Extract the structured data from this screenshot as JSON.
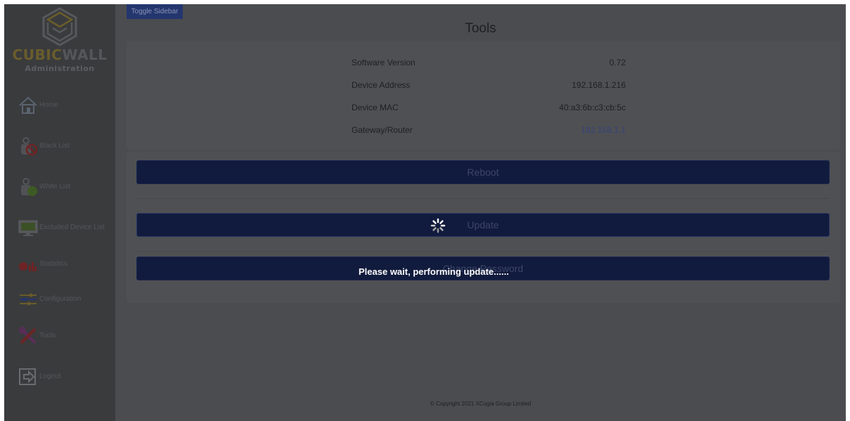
{
  "brand": {
    "name_part1": "CUBIC",
    "name_part2": "WALL",
    "subtitle": "Administration"
  },
  "sidebar": {
    "items": [
      {
        "label": "Home",
        "icon": "home-icon"
      },
      {
        "label": "Black List",
        "icon": "black-list-icon"
      },
      {
        "label": "White List",
        "icon": "white-list-icon"
      },
      {
        "label": "Excluded Device List",
        "icon": "monitor-icon"
      },
      {
        "label": "Statistics",
        "icon": "statistics-icon"
      },
      {
        "label": "Configuration",
        "icon": "sliders-icon"
      },
      {
        "label": "Tools",
        "icon": "tools-icon"
      },
      {
        "label": "Logout",
        "icon": "logout-icon"
      }
    ]
  },
  "header": {
    "toggle_label": "Toggle Sidebar",
    "title": "Tools"
  },
  "info": [
    {
      "label": "Software Version",
      "value": "0.72"
    },
    {
      "label": "Device Address",
      "value": "192.168.1.216"
    },
    {
      "label": "Device MAC",
      "value": "40:a3:6b:c3:cb:5c"
    },
    {
      "label": "Gateway/Router",
      "value": "192.168.1.1"
    }
  ],
  "actions": {
    "reboot": "Reboot",
    "update": "Update",
    "password": "Change Password"
  },
  "overlay": {
    "message": "Please wait, performing update......"
  },
  "footer": {
    "text": "© Copyright 2021 XCogia Group Limited"
  },
  "colors": {
    "sidebar": "#3a3b3d",
    "main": "#4b4c4f",
    "button": "#111b3d",
    "accent": "#24366e",
    "link": "#36427a"
  }
}
